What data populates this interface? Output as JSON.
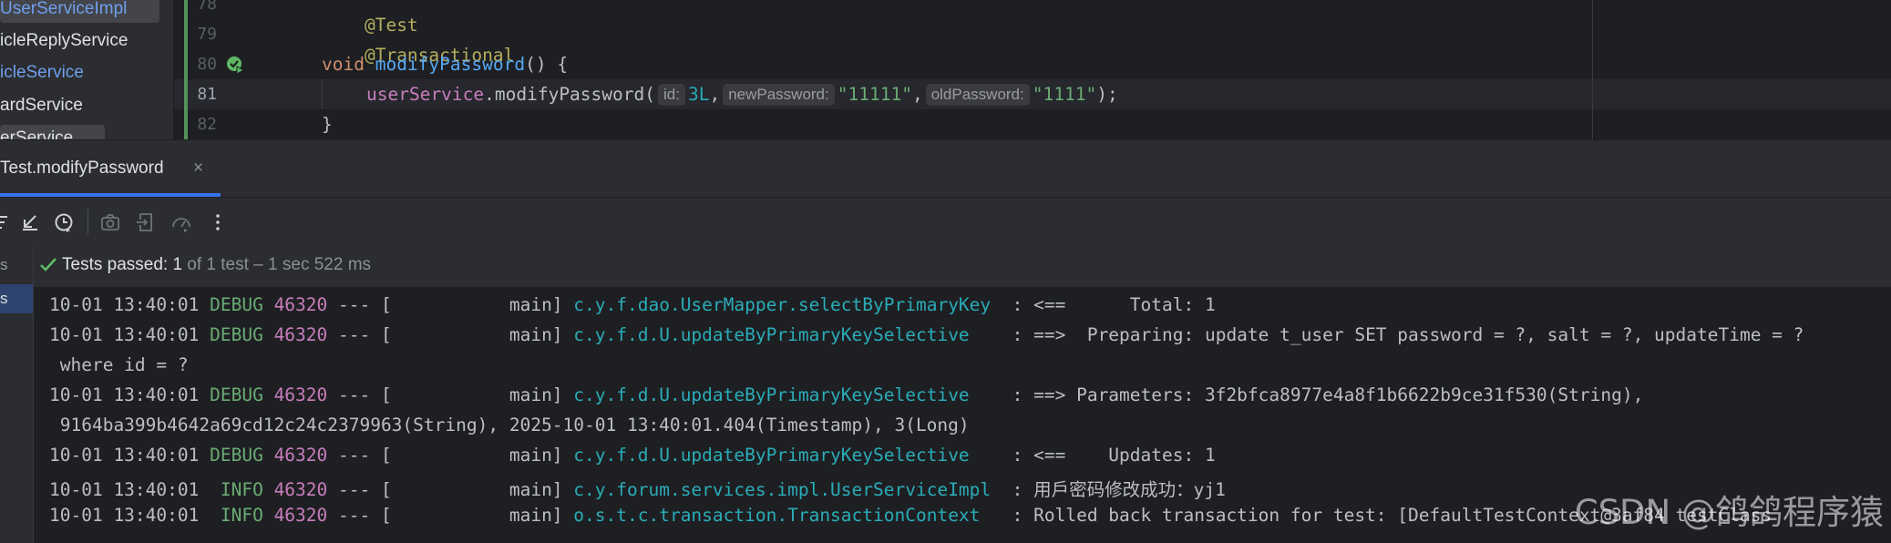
{
  "project_tree": {
    "items": [
      {
        "label": "UserServiceImpl",
        "style": "blue selected"
      },
      {
        "label": "icleReplyService",
        "style": "normal"
      },
      {
        "label": "icleService",
        "style": "blue"
      },
      {
        "label": "ardService",
        "style": "normal"
      },
      {
        "label": "erService",
        "style": "selected"
      }
    ]
  },
  "editor": {
    "lines": [
      {
        "num": "78",
        "annotation": "@Test"
      },
      {
        "num": "79",
        "annotation": "@Transactional"
      },
      {
        "num": "80",
        "kw": "void",
        "fn": "modifyPassword",
        "rest": "() {"
      },
      {
        "num": "81",
        "field": "userService",
        "call": ".modifyPassword(",
        "hint1": "id:",
        "arg1": "3L",
        "hint2": "newPassword:",
        "arg2": "\"11111\"",
        "hint3": "oldPassword:",
        "arg3": "\"1111\"",
        "end": ");"
      },
      {
        "num": "82",
        "text": "}"
      }
    ]
  },
  "run_window": {
    "tab_label": "Test.modifyPassword",
    "tab_close": "×",
    "status_icon": "check-icon",
    "status_passed": "Tests passed: 1",
    "status_detail": " of 1 test – 1 sec 522 ms",
    "left_items": [
      "s",
      "s"
    ]
  },
  "console": {
    "lines": [
      {
        "ts": "10-01 13:40:01 ",
        "level": "DEBUG",
        "pid": "46320",
        "sep": " --- [           main] ",
        "logger": "c.y.f.dao.UserMapper.selectByPrimaryKey",
        "msg": "  : <==      Total: 1"
      },
      {
        "ts": "10-01 13:40:01 ",
        "level": "DEBUG",
        "pid": "46320",
        "sep": " --- [           main] ",
        "logger": "c.y.f.d.U.updateByPrimaryKeySelective",
        "msg": "    : ==>  Preparing: update t_user SET password = ?, salt = ?, updateTime = ?"
      },
      {
        "text": " where id = ?"
      },
      {
        "ts": "10-01 13:40:01 ",
        "level": "DEBUG",
        "pid": "46320",
        "sep": " --- [           main] ",
        "logger": "c.y.f.d.U.updateByPrimaryKeySelective",
        "msg": "    : ==> Parameters: 3f2bfca8977e4a8f1b6622b9ce31f530(String),"
      },
      {
        "text": " 9164ba399b4642a69cd12c24c2379963(String), 2025-10-01 13:40:01.404(Timestamp), 3(Long)"
      },
      {
        "ts": "10-01 13:40:01 ",
        "level": "DEBUG",
        "pid": "46320",
        "sep": " --- [           main] ",
        "logger": "c.y.f.d.U.updateByPrimaryKeySelective",
        "msg": "    : <==    Updates: 1"
      },
      {
        "ts": "10-01 13:40:01  ",
        "level": "INFO",
        "pid": "46320",
        "sep": " --- [           main] ",
        "logger": "c.y.forum.services.impl.UserServiceImpl",
        "msg": "  : 用戶密码修改成功：yj1"
      },
      {
        "ts": "10-01 13:40:01  ",
        "level": "INFO",
        "pid": "46320",
        "sep": " --- [           main] ",
        "logger": "o.s.t.c.transaction.TransactionContext",
        "msg": "   : Rolled back transaction for test: [DefaultTestContext@3af84 testClass"
      }
    ]
  },
  "watermark": "CSDN @鸽鸽程序猿"
}
